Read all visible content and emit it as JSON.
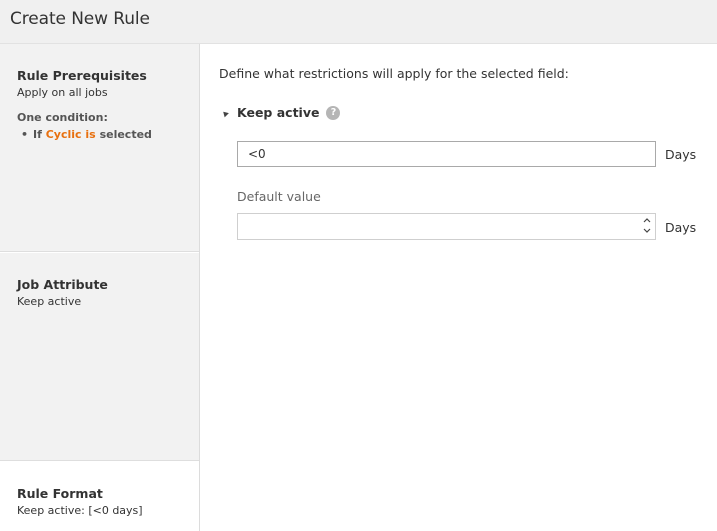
{
  "header": {
    "title": "Create New Rule"
  },
  "sidebar": {
    "prerequisites": {
      "title": "Rule Prerequisites",
      "subtitle": "Apply on all jobs",
      "condition_title": "One condition:",
      "condition": {
        "prefix": "If",
        "highlight": "Cyclic is",
        "suffix": "selected"
      }
    },
    "job_attribute": {
      "title": "Job Attribute",
      "value": "Keep active"
    },
    "rule_format": {
      "title": "Rule Format",
      "value": "Keep active: [<0 days]"
    }
  },
  "main": {
    "intro": "Define what restrictions will apply for the selected field:",
    "group": {
      "label": "Keep active",
      "help_icon": "?"
    },
    "restriction": {
      "value": "<0",
      "unit": "Days"
    },
    "default_value": {
      "label": "Default value",
      "value": "",
      "unit": "Days"
    }
  },
  "colors": {
    "accent": "#e8700f",
    "header_bg": "#f0f0f0",
    "sidebar_bg": "#f2f2f2"
  },
  "icons": {
    "group_toggle": "caret-down-icon",
    "help": "question-icon",
    "spin_up": "chevron-up-icon",
    "spin_down": "chevron-down-icon"
  }
}
